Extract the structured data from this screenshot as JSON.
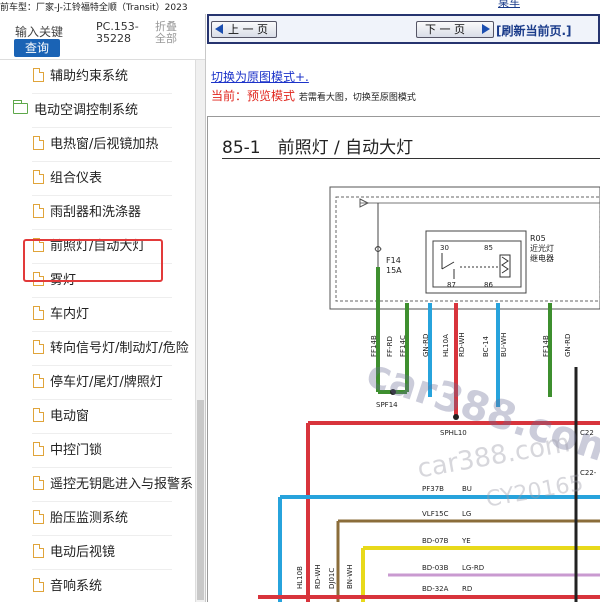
{
  "window": {
    "title": "前车型：厂家-J-江铃福特全顺（Transit）2023",
    "corner_link": "桌车"
  },
  "search": {
    "keyword_label": "输入关键",
    "query_button": "查询",
    "code": "PC.153-35228",
    "fold_label": "折叠全部"
  },
  "tree": {
    "items": [
      {
        "label": "辅助约束系统",
        "type": "doc"
      },
      {
        "label": "电动空调控制系统",
        "type": "folder"
      },
      {
        "label": "电热窗/后视镜加热",
        "type": "doc"
      },
      {
        "label": "组合仪表",
        "type": "doc"
      },
      {
        "label": "雨刮器和洗涤器",
        "type": "doc"
      },
      {
        "label": "前照灯/自动大灯",
        "type": "doc",
        "selected": true
      },
      {
        "label": "雾灯",
        "type": "doc"
      },
      {
        "label": "车内灯",
        "type": "doc"
      },
      {
        "label": "转向信号灯/制动灯/危险",
        "type": "doc"
      },
      {
        "label": "停车灯/尾灯/牌照灯",
        "type": "doc"
      },
      {
        "label": "电动窗",
        "type": "doc"
      },
      {
        "label": "中控门锁",
        "type": "doc"
      },
      {
        "label": "遥控无钥匙进入与报警系",
        "type": "doc"
      },
      {
        "label": "胎压监测系统",
        "type": "doc"
      },
      {
        "label": "电动后视镜",
        "type": "doc"
      },
      {
        "label": "音响系统",
        "type": "doc"
      }
    ]
  },
  "nav": {
    "prev_label": "上 一 页",
    "next_label": "下 一 页",
    "refresh_label": "[刷新当前页.]"
  },
  "view": {
    "switch_link": "切换为原图模式+.",
    "current_label": "当前：预览模式",
    "current_hint": "若需看大图，切换至原图模式"
  },
  "document": {
    "title": "85-1　前照灯 / 自动大灯",
    "fuse": {
      "name": "F14",
      "rating": "15A"
    },
    "relay": {
      "name": "R05",
      "desc1": "近光灯",
      "desc2": "继电器",
      "pins": [
        "30",
        "85",
        "87",
        "86"
      ]
    },
    "wire_labels": [
      "FF14B",
      "FF-RD",
      "FF14C",
      "GN-RD",
      "HL10A",
      "RD-WH",
      "BC-14",
      "BU-WH",
      "FF14B",
      "GN-RD"
    ],
    "splices": [
      "SPF14",
      "SPHL10"
    ],
    "connectors": [
      "C22",
      "C22-"
    ],
    "bus_rows": [
      {
        "circuit": "PF37B",
        "color": "BU"
      },
      {
        "circuit": "VLF15C",
        "color": "LG"
      },
      {
        "circuit": "BD-07B",
        "color": "YE"
      },
      {
        "circuit": "BD-03B",
        "color": "LG-RD"
      },
      {
        "circuit": "BD-32A",
        "color": "RD"
      }
    ],
    "bottom_labels": [
      "HL10B",
      "RD-WH",
      "DJ01C",
      "BN-WH"
    ],
    "watermarks": [
      "car388.com",
      "car388.com",
      "CY20165"
    ]
  },
  "colors": {
    "nav_border": "#26346f",
    "query_button": "#1a63b5",
    "highlight": "#e23a3a",
    "wire_green": "#3e8f2f",
    "wire_red": "#d8343c",
    "wire_blue": "#27a3dc",
    "wire_yellow": "#e8d91a",
    "wire_brown": "#8b6d3a"
  }
}
